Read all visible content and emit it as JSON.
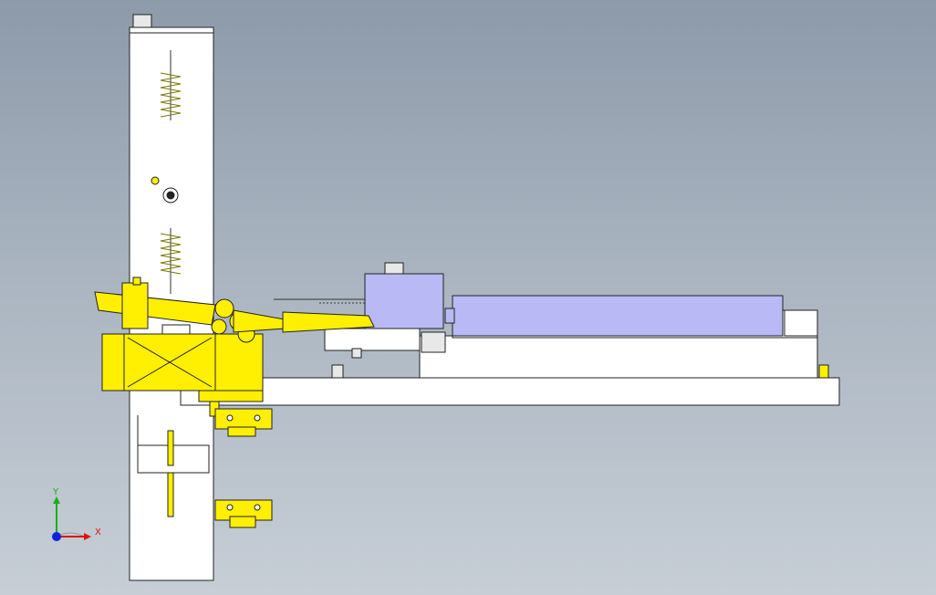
{
  "viewport": {
    "background_top": "#8d9aa9",
    "background_bottom": "#c7ced6"
  },
  "colors": {
    "part_white": "#ffffff",
    "part_yellow": "#ffef00",
    "part_lavender": "#b9b9f6",
    "edge": "#222222",
    "axis_x": "#e01010",
    "axis_y": "#18b018",
    "axis_z": "#1020e0"
  },
  "triad": {
    "x_label": "X",
    "y_label": "Y"
  }
}
